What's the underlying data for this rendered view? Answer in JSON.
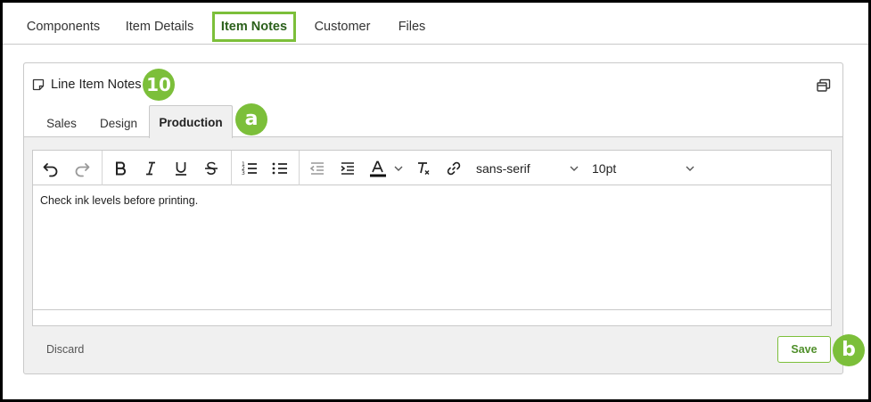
{
  "top_tabs": [
    {
      "label": "Components"
    },
    {
      "label": "Item Details"
    },
    {
      "label": "Item Notes",
      "active": true
    },
    {
      "label": "Customer"
    },
    {
      "label": "Files"
    }
  ],
  "panel": {
    "title": "Line Item Notes",
    "title_icon": "note-icon",
    "expand_icon": "restore-window-icon"
  },
  "callouts": {
    "title_badge": "10",
    "tab_badge": "a",
    "save_badge": "b",
    "color": "#7cbf3a"
  },
  "sub_tabs": [
    {
      "label": "Sales"
    },
    {
      "label": "Design"
    },
    {
      "label": "Production",
      "active": true
    }
  ],
  "toolbar": {
    "buttons": [
      "undo-icon",
      "redo-icon",
      "bold-icon",
      "italic-icon",
      "underline-icon",
      "strikethrough-icon",
      "numbered-list-icon",
      "bullet-list-icon",
      "outdent-icon",
      "indent-icon",
      "text-color-icon",
      "clear-formatting-icon",
      "link-icon"
    ],
    "font_family": "sans-serif",
    "font_size": "10pt"
  },
  "editor": {
    "content": "Check ink levels before printing."
  },
  "actions": {
    "discard_label": "Discard",
    "save_label": "Save"
  },
  "colors": {
    "accent": "#7cbf3a",
    "border": "#c9c9c9",
    "panel_bg": "#f0f0f0"
  }
}
